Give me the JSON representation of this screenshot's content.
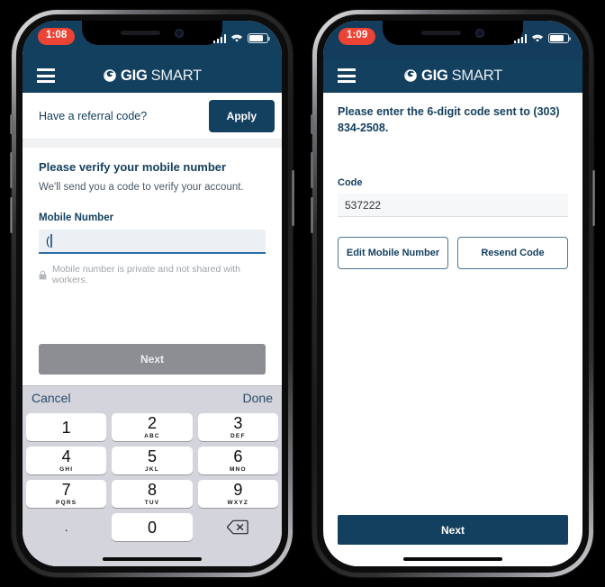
{
  "phone1": {
    "status": {
      "time": "1:08",
      "signal_icon": "cellular-signal-icon",
      "wifi_icon": "wifi-icon",
      "battery_icon": "battery-icon"
    },
    "header": {
      "menu_icon": "hamburger-menu-icon",
      "brand_mark": "gigsmart-logo-mark",
      "brand_primary": "GIG",
      "brand_secondary": "SMART"
    },
    "referral": {
      "label": "Have a referral code?",
      "apply_label": "Apply"
    },
    "form": {
      "title": "Please verify your mobile number",
      "subtitle": "We'll send you a code to verify your account.",
      "field_label": "Mobile Number",
      "field_value": "(",
      "privacy_icon": "lock-icon",
      "privacy_text": "Mobile number is private and not shared with workers."
    },
    "next_label": "Next",
    "keyboard": {
      "cancel_label": "Cancel",
      "done_label": "Done",
      "keys": [
        {
          "num": "1",
          "sub": ""
        },
        {
          "num": "2",
          "sub": "ABC"
        },
        {
          "num": "3",
          "sub": "DEF"
        },
        {
          "num": "4",
          "sub": "GHI"
        },
        {
          "num": "5",
          "sub": "JKL"
        },
        {
          "num": "6",
          "sub": "MNO"
        },
        {
          "num": "7",
          "sub": "PQRS"
        },
        {
          "num": "8",
          "sub": "TUV"
        },
        {
          "num": "9",
          "sub": "WXYZ"
        },
        {
          "num": ".",
          "sub": ""
        },
        {
          "num": "0",
          "sub": ""
        },
        {
          "num": "",
          "sub": "",
          "icon": "delete-backspace-icon"
        }
      ]
    }
  },
  "phone2": {
    "status": {
      "time": "1:09",
      "signal_icon": "cellular-signal-icon",
      "wifi_icon": "wifi-icon",
      "battery_icon": "battery-icon"
    },
    "header": {
      "menu_icon": "hamburger-menu-icon",
      "brand_mark": "gigsmart-logo-mark",
      "brand_primary": "GIG",
      "brand_secondary": "SMART"
    },
    "heading": "Please enter the 6-digit code sent to (303) 834-2508.",
    "code_label": "Code",
    "code_value": "537222",
    "edit_number_label": "Edit Mobile Number",
    "resend_label": "Resend Code",
    "next_label": "Next"
  },
  "colors": {
    "brand_navy": "#14405f",
    "accent_blue": "#2f6ea8",
    "disabled_gray": "#8c8e93",
    "time_badge_red": "#eb4334",
    "keyboard_bg": "#d3d4dc"
  }
}
